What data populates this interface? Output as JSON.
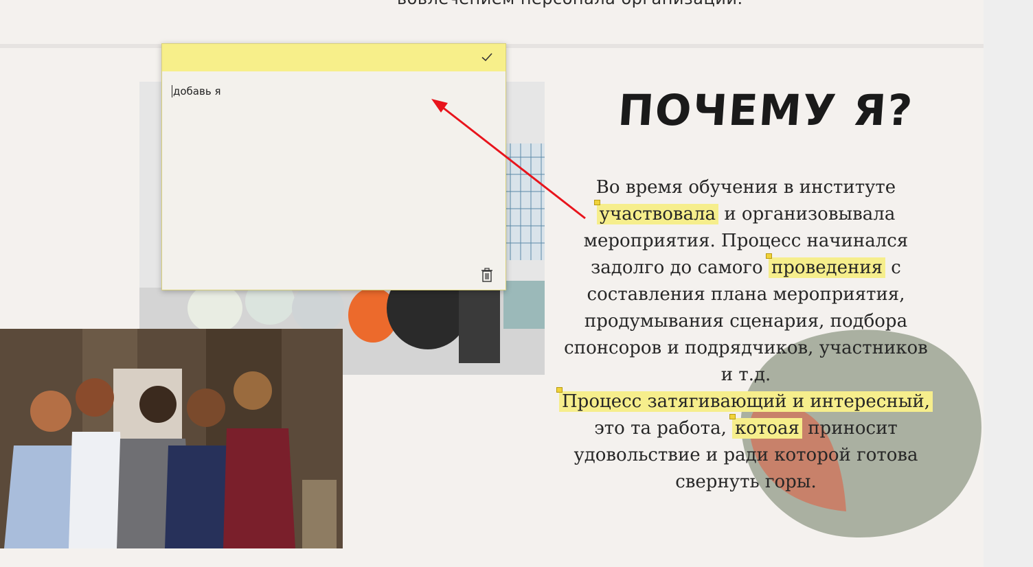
{
  "page": {
    "top_fragment": "вовлечением персонала организации.",
    "heading": "ПОЧЕМУ Я?"
  },
  "paragraph": {
    "l1": "Во время обучения в институте",
    "l2_hl": "участвовала",
    "l2_rest": " и организовывала",
    "l3": "мероприятия. Процесс начинался",
    "l4_start": "задолго до самого ",
    "l4_hl": "проведения",
    "l4_end": " с",
    "l5": "составления плана мероприятия,",
    "l6": "продумывания сценария, подбора",
    "l7": "спонсоров и подрядчиков, участников",
    "l8": "и т.д.",
    "l9_hl": "Процесс затягивающий и интересный,",
    "l10_start": "это та работа, ",
    "l10_hl": "котоая",
    "l10_end": " приносит",
    "l11": "удовольствие и ради которой готова",
    "l12": "свернуть горы."
  },
  "sticky_note": {
    "text": "добавь я",
    "confirm_icon": "checkmark-icon",
    "delete_icon": "trash-icon"
  },
  "colors": {
    "highlight": "#f6ee8c",
    "sticky_bar": "#f7ef8a",
    "arrow": "#e8141c",
    "blob_green": "#aab0a1",
    "blob_terracotta": "#c8816a"
  }
}
